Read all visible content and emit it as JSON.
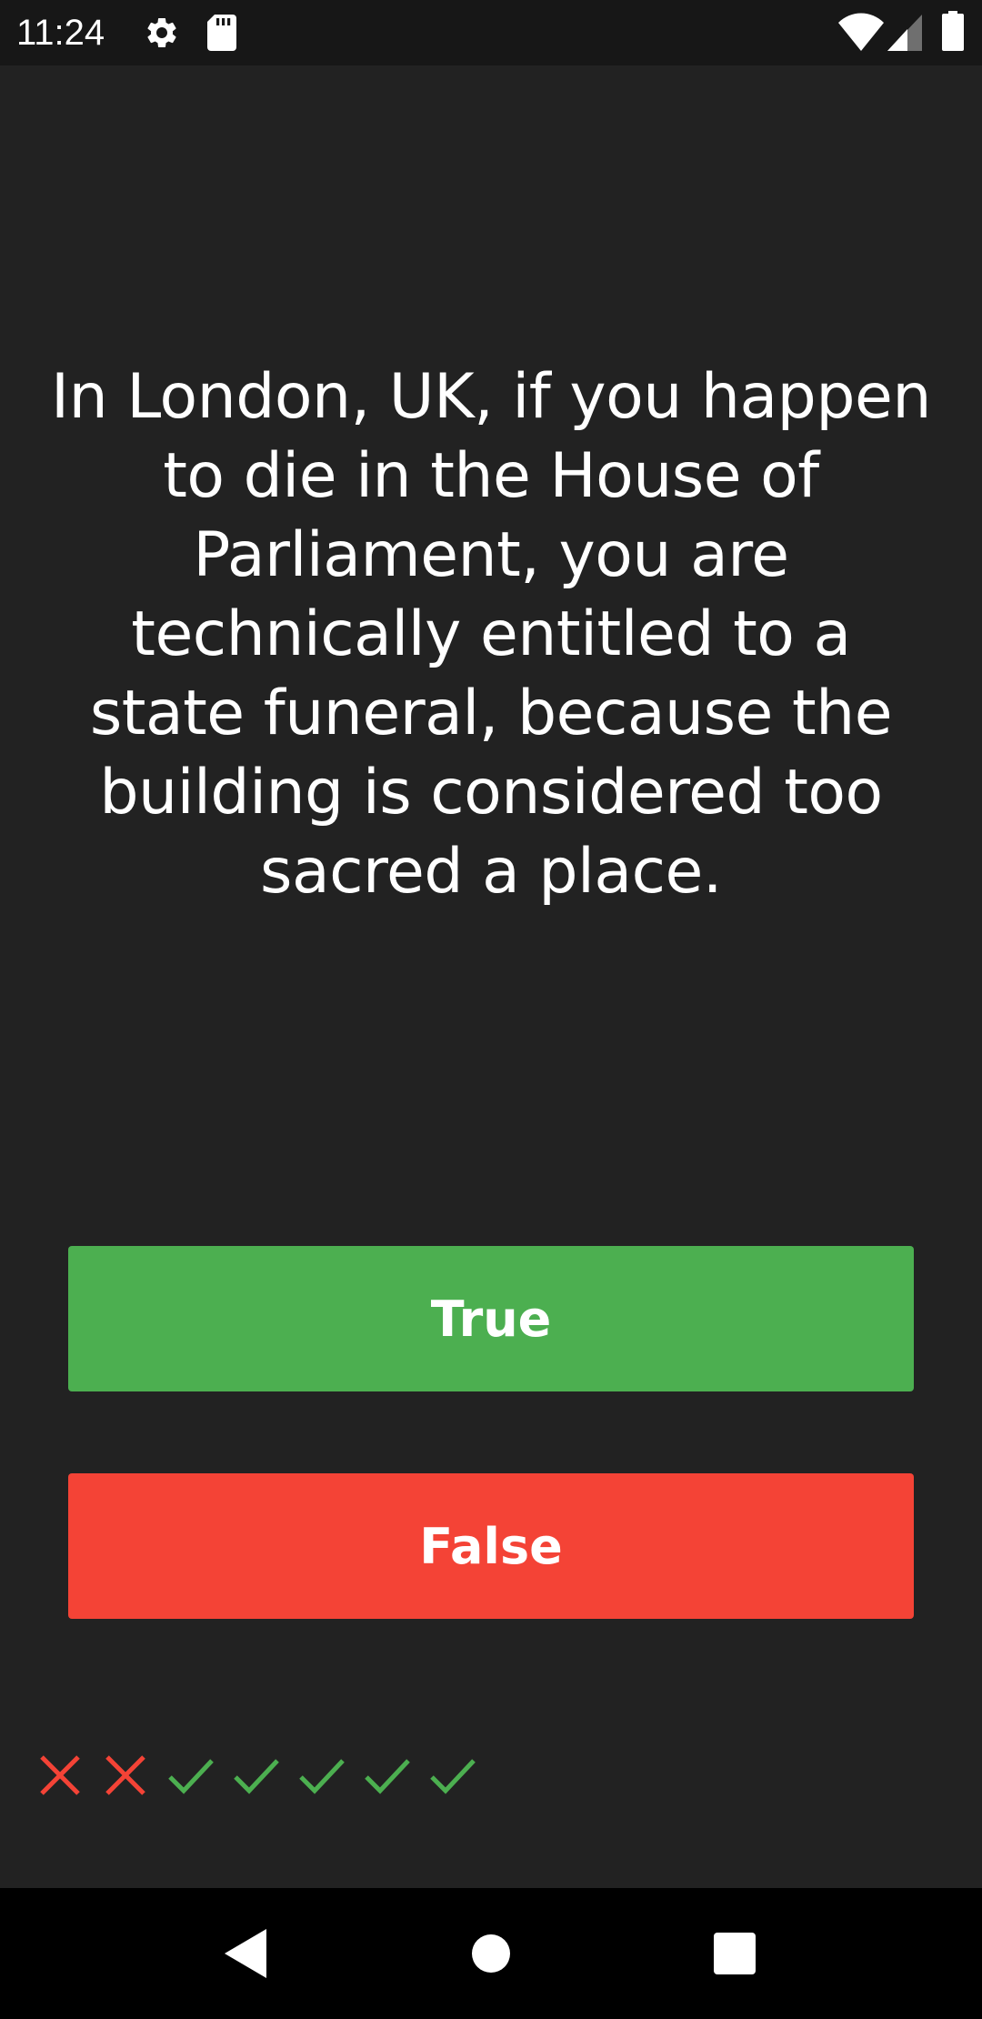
{
  "status_bar": {
    "time": "11:24",
    "icons": [
      "gear-icon",
      "sd-card-icon",
      "wifi-icon",
      "signal-icon",
      "battery-icon"
    ]
  },
  "quiz": {
    "question": "In London, UK, if you happen to die in the House of Parliament, you are technically entitled to a state funeral, because the building is considered too sacred a place.",
    "true_label": "True",
    "false_label": "False",
    "history": [
      "wrong",
      "wrong",
      "correct",
      "correct",
      "correct",
      "correct",
      "correct"
    ]
  },
  "colors": {
    "background": "#222222",
    "true": "#4caf50",
    "false": "#f44336",
    "correct_mark": "#4caf50",
    "wrong_mark": "#f44336"
  },
  "nav_bar": {
    "icons": [
      "back-icon",
      "home-icon",
      "recents-icon"
    ]
  }
}
